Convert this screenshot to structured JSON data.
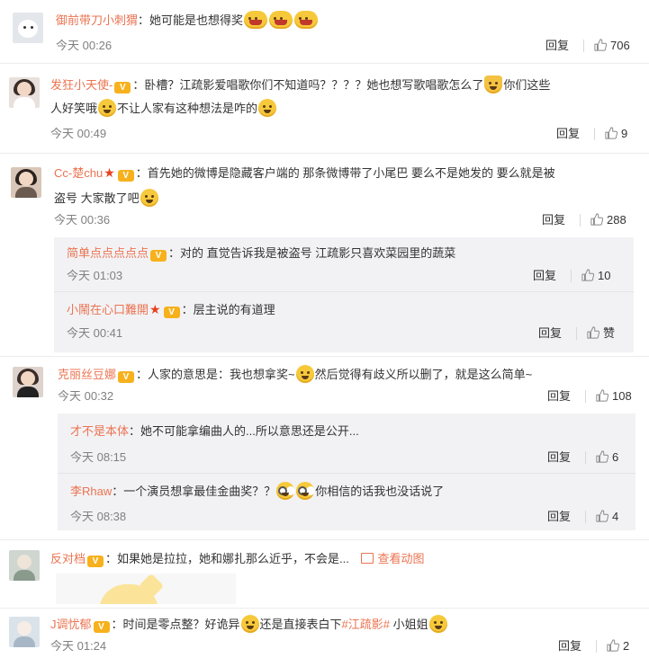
{
  "comments": [
    {
      "user": "御前带刀小刺猬",
      "text": "：她可能是也想得奖",
      "time": "今天 00:26",
      "reply_label": "回复",
      "likes": "706"
    },
    {
      "user": "发狂小天使-",
      "text_line1": "：卧槽？江疏影爱唱歌你们不知道吗？？？？她也想写歌唱歌怎么了",
      "text_line1_tail": "你们这些",
      "text_line2": "人好笑哦",
      "text_line2_mid": "不让人家有这种想法是咋的",
      "time": "今天 00:49",
      "reply_label": "回复",
      "likes": "9"
    },
    {
      "user": "Cc-楚chu",
      "text_line1": "：首先她的微博是隐藏客户端的 那条微博带了小尾巴 要么不是她发的 要么就是被",
      "text_line2": "盗号 大家散了吧",
      "time": "今天 00:36",
      "reply_label": "回复",
      "likes": "288",
      "replies": [
        {
          "user": "简单点点点点点",
          "text": "：对的 直觉告诉我是被盗号 江疏影只喜欢菜园里的蔬菜",
          "time": "今天 01:03",
          "reply_label": "回复",
          "likes": "10"
        },
        {
          "user": "小鬧在心口難開",
          "text": "：层主说的有道理",
          "time": "今天 00:41",
          "reply_label": "回复",
          "likes": "赞"
        }
      ]
    },
    {
      "user": "克丽丝豆娜",
      "text": "：人家的意思是：我也想拿奖~",
      "text_tail": "然后觉得有歧义所以删了，就是这么简单~",
      "time": "今天 00:32",
      "reply_label": "回复",
      "likes": "108",
      "replies": [
        {
          "user": "才不是本体",
          "text": "：她不可能拿编曲人的...所以意思还是公开...",
          "time": "今天 08:15",
          "reply_label": "回复",
          "likes": "6"
        },
        {
          "user": "李Rhaw",
          "text": "：一个演员想拿最佳金曲奖？？",
          "text_tail": "你相信的话我也没话说了",
          "time": "今天 08:38",
          "reply_label": "回复",
          "likes": "4"
        }
      ]
    },
    {
      "user": "反对档",
      "text": "：如果她是拉拉，她和娜扎那么近乎，不会是...",
      "view_image": "查看动图"
    },
    {
      "user": "J调忧郁",
      "text": "：时间是零点整？好诡异",
      "text_mid": "还是直接表白下",
      "hashtag": "#江疏影#",
      "text_tail": " 小姐姐",
      "time": "今天 01:24",
      "reply_label": "回复",
      "likes": "2"
    }
  ],
  "icons": {
    "thumb": "thumbs-up-icon",
    "badge": "vip-badge-icon",
    "star": "star-icon",
    "emoji": "emoji-icon",
    "picture": "picture-icon"
  },
  "colors": {
    "username": "#eb7350",
    "text": "#333333",
    "time": "#808080",
    "reply_bg": "#f2f2f5"
  }
}
